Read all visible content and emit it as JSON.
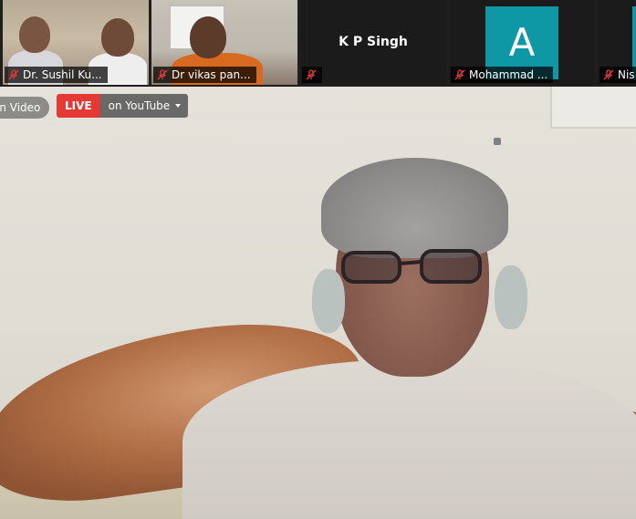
{
  "participants": [
    {
      "name": "Dr. Sushil Ku...",
      "video": true
    },
    {
      "name": "Dr vikas pan...",
      "video": true
    },
    {
      "name": "K P Singh",
      "video": false
    },
    {
      "name": "Mohammad ...",
      "video": false,
      "avatar_letter": "A",
      "avatar_color": "#0e97a5"
    },
    {
      "name": "Nis",
      "video": false
    }
  ],
  "overlay": {
    "pin_video_label": "in Video",
    "live_label": "LIVE",
    "live_target": "on YouTube",
    "live_color": "#e53935"
  },
  "icons": {
    "muted": "mic-muted-icon",
    "dropdown": "chevron-down-icon"
  }
}
